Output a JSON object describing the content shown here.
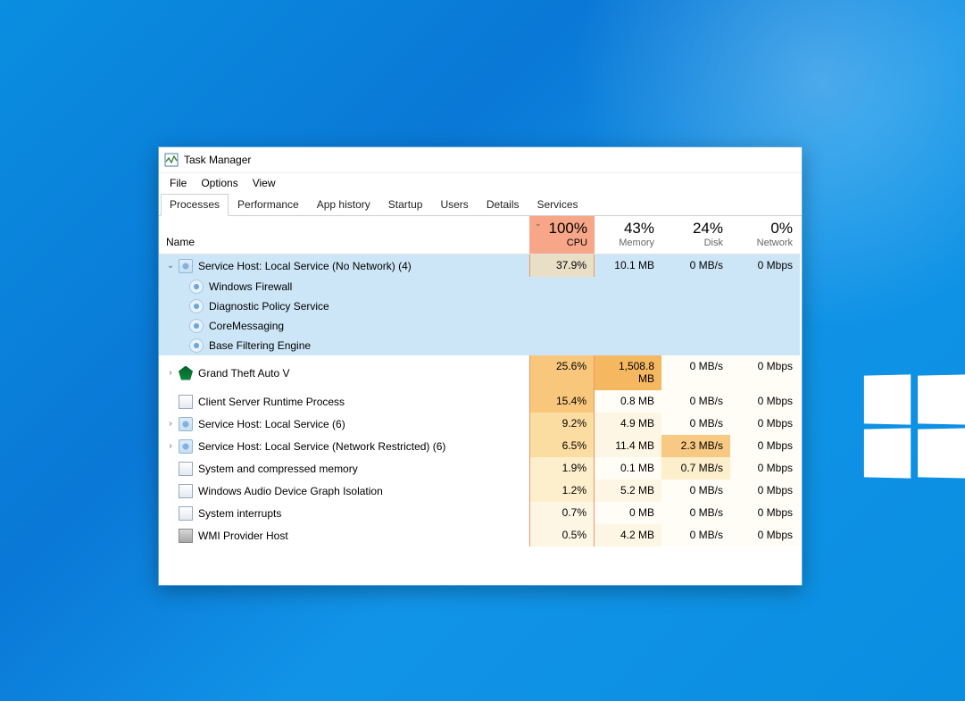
{
  "window": {
    "title": "Task Manager"
  },
  "menu": {
    "file": "File",
    "options": "Options",
    "view": "View"
  },
  "tabs": {
    "processes": "Processes",
    "performance": "Performance",
    "app_history": "App history",
    "startup": "Startup",
    "users": "Users",
    "details": "Details",
    "services": "Services"
  },
  "headers": {
    "name": "Name",
    "cpu_pct": "100%",
    "cpu_lbl": "CPU",
    "mem_pct": "43%",
    "mem_lbl": "Memory",
    "disk_pct": "24%",
    "disk_lbl": "Disk",
    "net_pct": "0%",
    "net_lbl": "Network"
  },
  "rows": [
    {
      "name": "Service Host: Local Service (No Network) (4)",
      "cpu": "37.9%",
      "mem": "10.1 MB",
      "disk": "0 MB/s",
      "net": "0 Mbps"
    },
    {
      "name": "Grand Theft Auto V",
      "cpu": "25.6%",
      "mem": "1,508.8 MB",
      "disk": "0 MB/s",
      "net": "0 Mbps"
    },
    {
      "name": "Client Server Runtime Process",
      "cpu": "15.4%",
      "mem": "0.8 MB",
      "disk": "0 MB/s",
      "net": "0 Mbps"
    },
    {
      "name": "Service Host: Local Service (6)",
      "cpu": "9.2%",
      "mem": "4.9 MB",
      "disk": "0 MB/s",
      "net": "0 Mbps"
    },
    {
      "name": "Service Host: Local Service (Network Restricted) (6)",
      "cpu": "6.5%",
      "mem": "11.4 MB",
      "disk": "2.3 MB/s",
      "net": "0 Mbps"
    },
    {
      "name": "System and compressed memory",
      "cpu": "1.9%",
      "mem": "0.1 MB",
      "disk": "0.7 MB/s",
      "net": "0 Mbps"
    },
    {
      "name": "Windows Audio Device Graph Isolation",
      "cpu": "1.2%",
      "mem": "5.2 MB",
      "disk": "0 MB/s",
      "net": "0 Mbps"
    },
    {
      "name": "System interrupts",
      "cpu": "0.7%",
      "mem": "0 MB",
      "disk": "0 MB/s",
      "net": "0 Mbps"
    },
    {
      "name": "WMI Provider Host",
      "cpu": "0.5%",
      "mem": "4.2 MB",
      "disk": "0 MB/s",
      "net": "0 Mbps"
    }
  ],
  "sub": {
    "firewall": "Windows Firewall",
    "diag": "Diagnostic Policy Service",
    "core": "CoreMessaging",
    "bfe": "Base Filtering Engine"
  }
}
